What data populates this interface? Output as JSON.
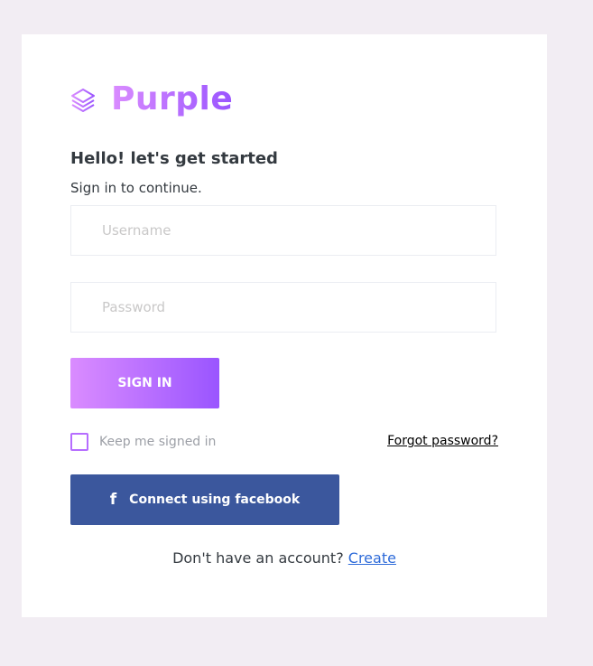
{
  "brand": {
    "name": "Purple",
    "icon": "layers-icon",
    "accent_start": "#da8cff",
    "accent_end": "#9a55ff"
  },
  "form": {
    "heading": "Hello! let's get started",
    "subheading": "Sign in to continue.",
    "username": {
      "value": "",
      "placeholder": "Username"
    },
    "password": {
      "value": "",
      "placeholder": "Password"
    },
    "signin_label": "SIGN IN",
    "keep_signed_in": {
      "label": "Keep me signed in",
      "checked": false
    },
    "forgot_label": "Forgot password?",
    "facebook": {
      "icon": "facebook-icon",
      "label": "Connect using facebook",
      "color": "#3b579d"
    },
    "footer": {
      "text": "Don't have an account? ",
      "link": "Create"
    }
  }
}
